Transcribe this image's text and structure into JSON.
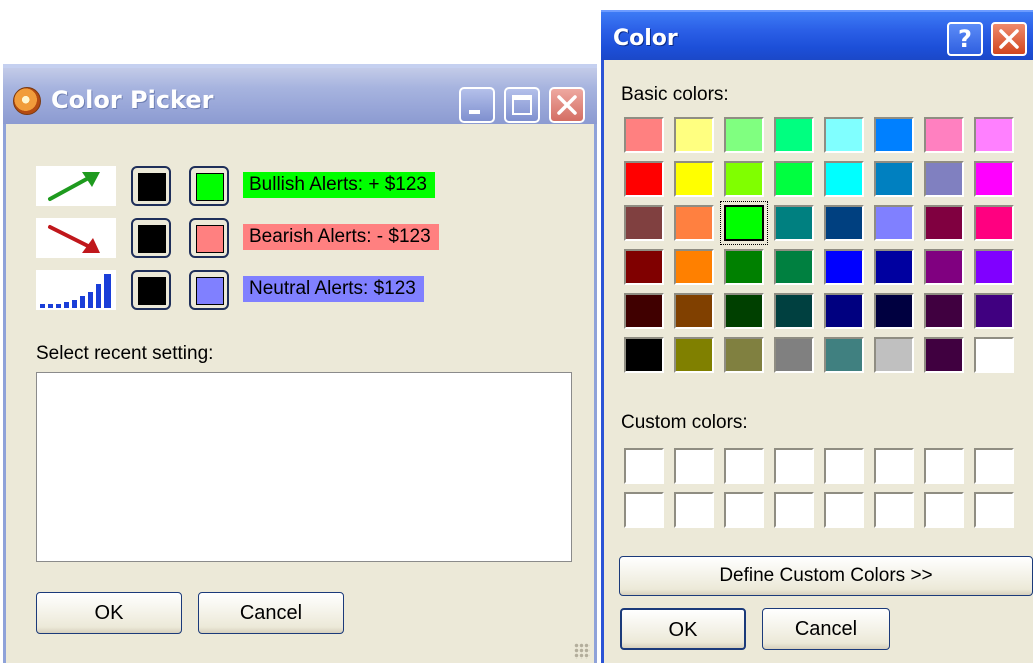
{
  "picker_window": {
    "title": "Color Picker",
    "alerts": [
      {
        "icon": "bullish-arrow-icon",
        "label": "Bullish Alerts:  + $123",
        "fg_color": "#000000",
        "bg_color": "#00ff00"
      },
      {
        "icon": "bearish-arrow-icon",
        "label": "Bearish Alerts:  - $123",
        "fg_color": "#000000",
        "bg_color": "#ff8080"
      },
      {
        "icon": "neutral-bars-icon",
        "label": "Neutral Alerts:  $123",
        "fg_color": "#000000",
        "bg_color": "#8080ff"
      }
    ],
    "recent_label": "Select recent setting:",
    "ok_label": "OK",
    "cancel_label": "Cancel"
  },
  "color_dialog": {
    "title": "Color",
    "help_label": "?",
    "basic_colors_label": "Basic colors:",
    "basic_colors": [
      [
        "#ff8080",
        "#ffff80",
        "#80ff80",
        "#00ff80",
        "#80ffff",
        "#0080ff",
        "#ff80c0",
        "#ff80ff"
      ],
      [
        "#ff0000",
        "#ffff00",
        "#80ff00",
        "#00ff40",
        "#00ffff",
        "#0080c0",
        "#8080c0",
        "#ff00ff"
      ],
      [
        "#804040",
        "#ff8040",
        "#00ff00",
        "#008080",
        "#004080",
        "#8080ff",
        "#800040",
        "#ff0080"
      ],
      [
        "#800000",
        "#ff8000",
        "#008000",
        "#008040",
        "#0000ff",
        "#0000a0",
        "#800080",
        "#8000ff"
      ],
      [
        "#400000",
        "#804000",
        "#004000",
        "#004040",
        "#000080",
        "#000040",
        "#400040",
        "#400080"
      ],
      [
        "#000000",
        "#808000",
        "#808040",
        "#808080",
        "#408080",
        "#c0c0c0",
        "#400040",
        "#ffffff"
      ]
    ],
    "selected_color": "#00ff00",
    "custom_colors_label": "Custom colors:",
    "custom_colors": [
      [
        "#ffffff",
        "#ffffff",
        "#ffffff",
        "#ffffff",
        "#ffffff",
        "#ffffff",
        "#ffffff",
        "#ffffff"
      ],
      [
        "#ffffff",
        "#ffffff",
        "#ffffff",
        "#ffffff",
        "#ffffff",
        "#ffffff",
        "#ffffff",
        "#ffffff"
      ]
    ],
    "define_custom_label": "Define Custom Colors >>",
    "ok_label": "OK",
    "cancel_label": "Cancel"
  }
}
